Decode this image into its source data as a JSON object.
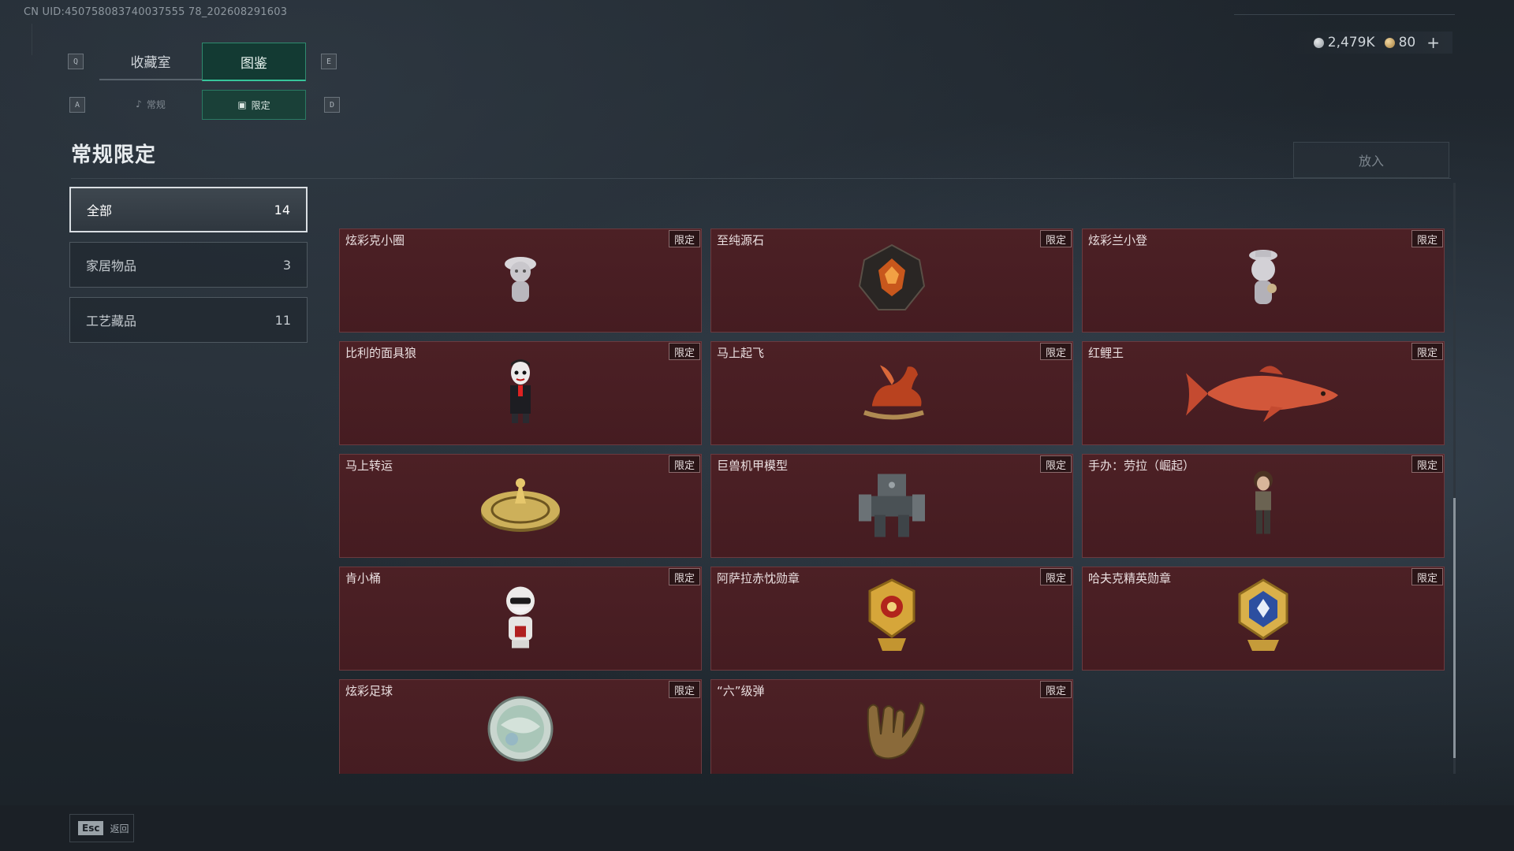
{
  "uid": "CN UID:450758083740037555 78_202608291603",
  "currency": {
    "silver": "2,479K",
    "gold": "80",
    "plus": "+"
  },
  "keys": {
    "q": "Q",
    "e": "E",
    "a": "A",
    "d": "D"
  },
  "tabs": [
    {
      "label": "收藏室"
    },
    {
      "label": "图鉴"
    }
  ],
  "subtabs": [
    {
      "label": "常规",
      "icon": "bell-icon"
    },
    {
      "label": "限定",
      "icon": "picture-icon"
    }
  ],
  "page_title": "常规限定",
  "put_button": "放入",
  "categories": [
    {
      "label": "全部",
      "count": "14"
    },
    {
      "label": "家居物品",
      "count": "3"
    },
    {
      "label": "工艺藏品",
      "count": "11"
    }
  ],
  "items": [
    {
      "name": "炫彩克小圈",
      "tag": "限定",
      "icon": "figurine-icon"
    },
    {
      "name": "至纯源石",
      "tag": "限定",
      "icon": "gem-icon"
    },
    {
      "name": "炫彩兰小登",
      "tag": "限定",
      "icon": "figurine-icon"
    },
    {
      "name": "比利的面具狼",
      "tag": "限定",
      "icon": "puppet-icon"
    },
    {
      "name": "马上起飞",
      "tag": "限定",
      "icon": "horse-icon"
    },
    {
      "name": "红鲤王",
      "tag": "限定",
      "icon": "fish-icon"
    },
    {
      "name": "马上转运",
      "tag": "限定",
      "icon": "wheel-icon"
    },
    {
      "name": "巨兽机甲模型",
      "tag": "限定",
      "icon": "mech-icon"
    },
    {
      "name": "手办：劳拉（崛起）",
      "tag": "限定",
      "icon": "figure-icon"
    },
    {
      "name": "肯小桶",
      "tag": "限定",
      "icon": "colonel-icon"
    },
    {
      "name": "阿萨拉赤忱勋章",
      "tag": "限定",
      "icon": "medal-icon"
    },
    {
      "name": "哈夫克精英勋章",
      "tag": "限定",
      "icon": "medal-icon"
    },
    {
      "name": "炫彩足球",
      "tag": "限定",
      "icon": "football-icon"
    },
    {
      "name": "“六”级弹",
      "tag": "限定",
      "icon": "hand-icon"
    }
  ],
  "esc": {
    "key": "Esc",
    "label": "返回"
  }
}
